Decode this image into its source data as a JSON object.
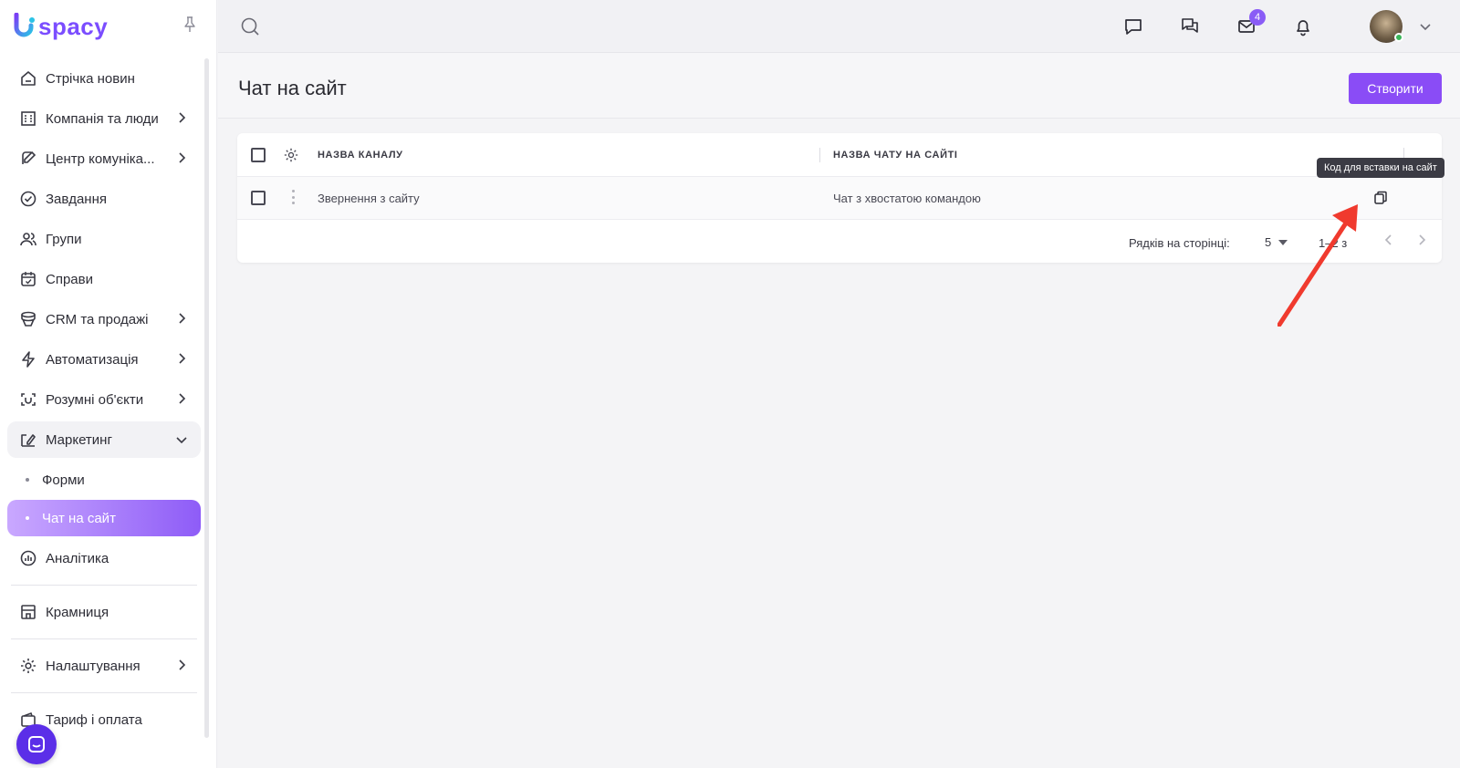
{
  "app": {
    "logo_text": "spacy"
  },
  "sidebar": {
    "items": [
      {
        "label": "Стрічка новин",
        "icon": "home-icon",
        "chevron": false
      },
      {
        "label": "Компанія та люди",
        "icon": "building-icon",
        "chevron": true
      },
      {
        "label": "Центр комуніка...",
        "icon": "communication-icon",
        "chevron": true
      },
      {
        "label": "Завдання",
        "icon": "check-circle-icon",
        "chevron": false
      },
      {
        "label": "Групи",
        "icon": "users-icon",
        "chevron": false
      },
      {
        "label": "Справи",
        "icon": "calendar-icon",
        "chevron": false
      },
      {
        "label": "CRM та продажі",
        "icon": "database-icon",
        "chevron": true
      },
      {
        "label": "Автоматизація",
        "icon": "lightning-icon",
        "chevron": true
      },
      {
        "label": "Розумні об'єкти",
        "icon": "smart-object-icon",
        "chevron": true
      },
      {
        "label": "Маркетинг",
        "icon": "marketing-icon",
        "chevron": true,
        "expanded": true
      }
    ],
    "sub_items": [
      {
        "label": "Форми",
        "active": false
      },
      {
        "label": "Чат на сайт",
        "active": true
      }
    ],
    "items_after": [
      {
        "label": "Аналітика",
        "icon": "chart-icon"
      }
    ],
    "shop": {
      "label": "Крамниця",
      "icon": "store-icon"
    },
    "settings": {
      "label": "Налаштування",
      "icon": "gear-icon"
    },
    "billing": {
      "label": "Тариф і оплата",
      "icon": "wallet-icon"
    }
  },
  "topbar": {
    "mail_badge": "4"
  },
  "page": {
    "title": "Чат на сайт",
    "create_label": "Створити"
  },
  "table": {
    "columns": [
      "НАЗВА КАНАЛУ",
      "НАЗВА ЧАТУ НА САЙТІ"
    ],
    "rows": [
      {
        "channel": "Звернення з сайту",
        "chat_name": "Чат з хвостатою командою"
      }
    ],
    "tooltip": "Код для вставки на сайт",
    "pagination": {
      "rows_label": "Рядків на сторінці:",
      "rows_value": "5",
      "range": "1–2 з"
    }
  },
  "colors": {
    "accent": "#8a4cf6",
    "annotation_arrow": "#f03a2e"
  }
}
